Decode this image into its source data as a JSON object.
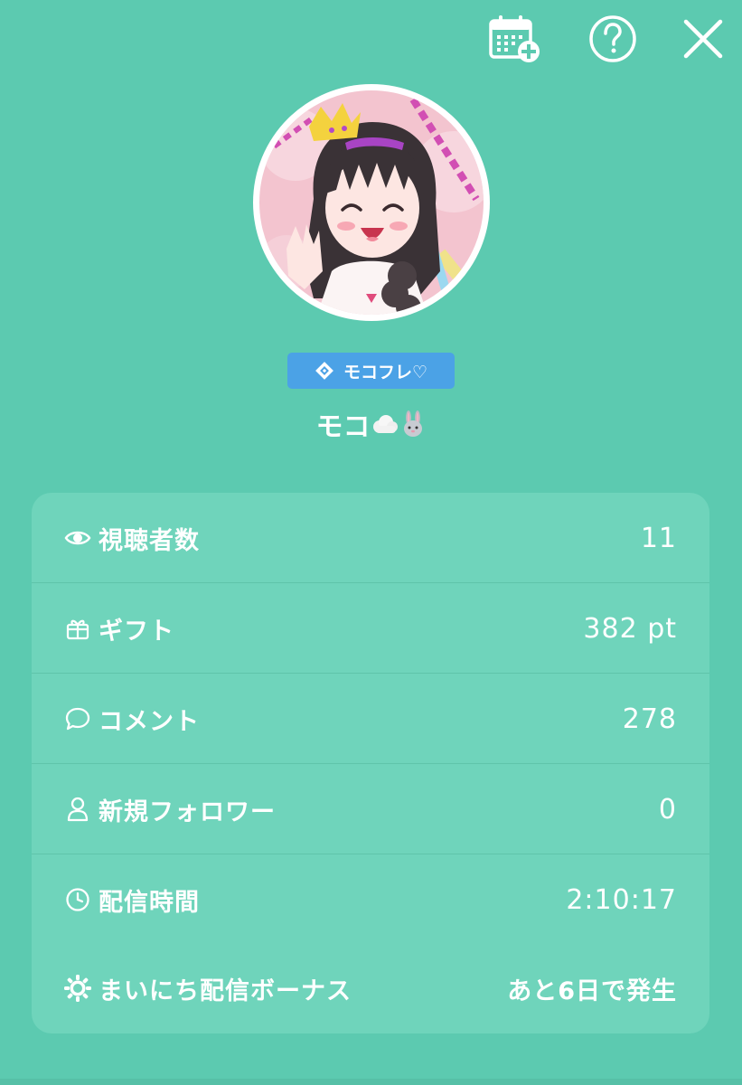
{
  "top_bar": {
    "icons": [
      "calendar-add-icon",
      "help-icon",
      "close-icon"
    ]
  },
  "profile": {
    "badge_label": "モコフレ♡",
    "name": "モコ"
  },
  "stats": [
    {
      "icon": "eye-icon",
      "label": "視聴者数",
      "value": "11"
    },
    {
      "icon": "gift-icon",
      "label": "ギフト",
      "value": "382 pt"
    },
    {
      "icon": "comment-icon",
      "label": "コメント",
      "value": "278"
    },
    {
      "icon": "user-icon",
      "label": "新規フォロワー",
      "value": "0"
    },
    {
      "icon": "clock-icon",
      "label": "配信時間",
      "value": "2:10:17"
    },
    {
      "icon": "sun-icon",
      "label": "まいにち配信ボーナス",
      "value": "あと6日で発生"
    }
  ],
  "colors": {
    "background": "#5ccab0",
    "card": "#6fd4bb",
    "badge": "#4ba2e6",
    "text": "#ffffff"
  }
}
